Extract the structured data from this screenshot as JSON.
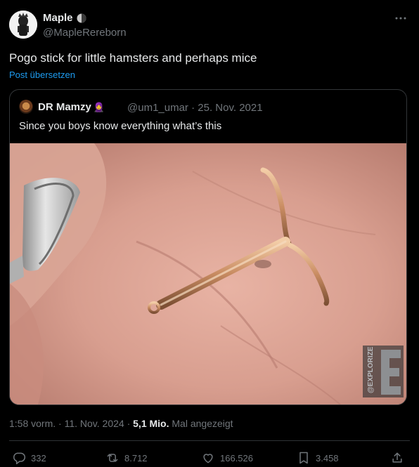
{
  "author": {
    "name": "Maple",
    "handle": "@MapleRereborn",
    "badge_icon": "moon-icon"
  },
  "tweet": {
    "text": "Pogo stick for little hamsters and perhaps mice",
    "translate_label": "Post übersetzen"
  },
  "quote": {
    "name": "DR Mamzy",
    "badge": "🧕",
    "handle": "@um1_umar",
    "date": "25. Nov. 2021",
    "meta_separator": "·",
    "text": "Since you boys know everything what’s this",
    "watermark": "@EXPLORIZE"
  },
  "meta": {
    "time": "1:58 vorm.",
    "date": "11. Nov. 2024",
    "separator": "·",
    "views_value": "5,1 Mio.",
    "views_label": "Mal angezeigt"
  },
  "actions": {
    "replies": "332",
    "reposts": "8.712",
    "likes": "166.526",
    "bookmarks": "3.458"
  },
  "colors": {
    "background": "#000000",
    "text": "#e7e9ea",
    "secondary": "#71767b",
    "link": "#1d9bf0",
    "border": "#333639"
  }
}
